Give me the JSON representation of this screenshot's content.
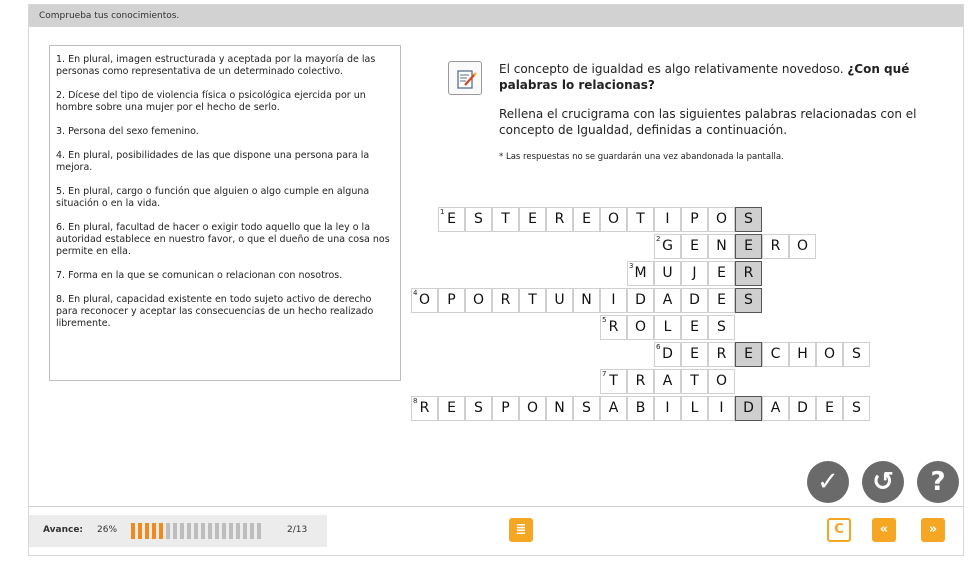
{
  "header": {
    "title": "Comprueba tus conocimientos."
  },
  "clues": [
    "1. En plural, imagen estructurada y aceptada por la mayoría de las personas como representativa de un determinado colectivo.",
    "2. Dícese del tipo de violencia física o psicológica ejercida por un hombre sobre una mujer por el hecho de serlo.",
    "3. Persona del sexo femenino.",
    "4. En plural, posibilidades de las que dispone una persona para la mejora.",
    "5. En plural, cargo o función que alguien o algo cumple en alguna situación o en la vida.",
    "6. En plural, facultad de hacer o exigir todo aquello que la ley o la autoridad establece en nuestro favor, o que el dueño de una cosa nos permite en ella.",
    "7. Forma en la que se comunican o relacionan con nosotros.",
    "8. En plural, capacidad existente en todo sujeto activo de derecho para reconocer y aceptar las consecuencias de un hecho realizado libremente."
  ],
  "question": {
    "intro": "El concepto de igualdad es algo relativamente novedoso. ",
    "bold": "¿Con qué palabras lo relacionas?"
  },
  "instruction": "Rellena el crucigrama con las siguientes palabras relacionadas con el concepto de Igualdad, definidas a continuación.",
  "note": "* Las respuestas no se guardarán una vez abandonada la pantalla.",
  "crossword": {
    "key_column": 12,
    "rows": [
      {
        "num": "1",
        "start": 1,
        "word": "ESTEREOTIPOS"
      },
      {
        "num": "2",
        "start": 9,
        "word": "GENERO"
      },
      {
        "num": "3",
        "start": 8,
        "word": "MUJER"
      },
      {
        "num": "4",
        "start": 0,
        "word": "OPORTUNIDADES"
      },
      {
        "num": "5",
        "start": 7,
        "word": "ROLES"
      },
      {
        "num": "6",
        "start": 9,
        "word": "DERECHOS"
      },
      {
        "num": "7",
        "start": 7,
        "word": "TRATO"
      },
      {
        "num": "8",
        "start": 0,
        "word": "RESPONSABILIDADES"
      }
    ]
  },
  "controls": {
    "check": "✓",
    "reset": "↺",
    "help": "?"
  },
  "progress": {
    "label": "Avance:",
    "percent_text": "26%",
    "fraction": 0.26,
    "total_bars": 19,
    "count": "2/13"
  },
  "nav": {
    "index": "≣",
    "reload": "C",
    "prev": "«",
    "next": "»"
  },
  "colors": {
    "accent": "#f5a623",
    "progress": "#f08a1d",
    "round_button": "#6a6a6a"
  }
}
